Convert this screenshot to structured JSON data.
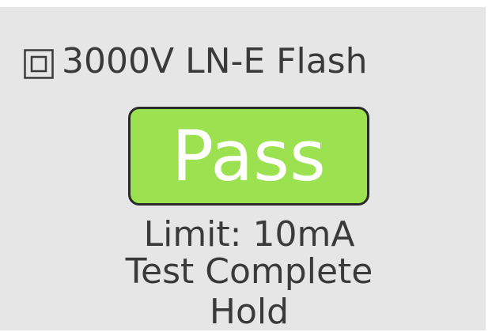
{
  "header": {
    "icon": "class-2-double-square-icon",
    "title": "3000V LN-E Flash"
  },
  "result": {
    "label": "Pass",
    "background_color": "#9be150"
  },
  "info": {
    "limit": "Limit: 10mA",
    "status": "Test Complete",
    "hold": "Hold"
  },
  "colors": {
    "screen_background": "#e6e6e6",
    "text": "#3a3a3a",
    "pass_text": "#ffffff"
  }
}
